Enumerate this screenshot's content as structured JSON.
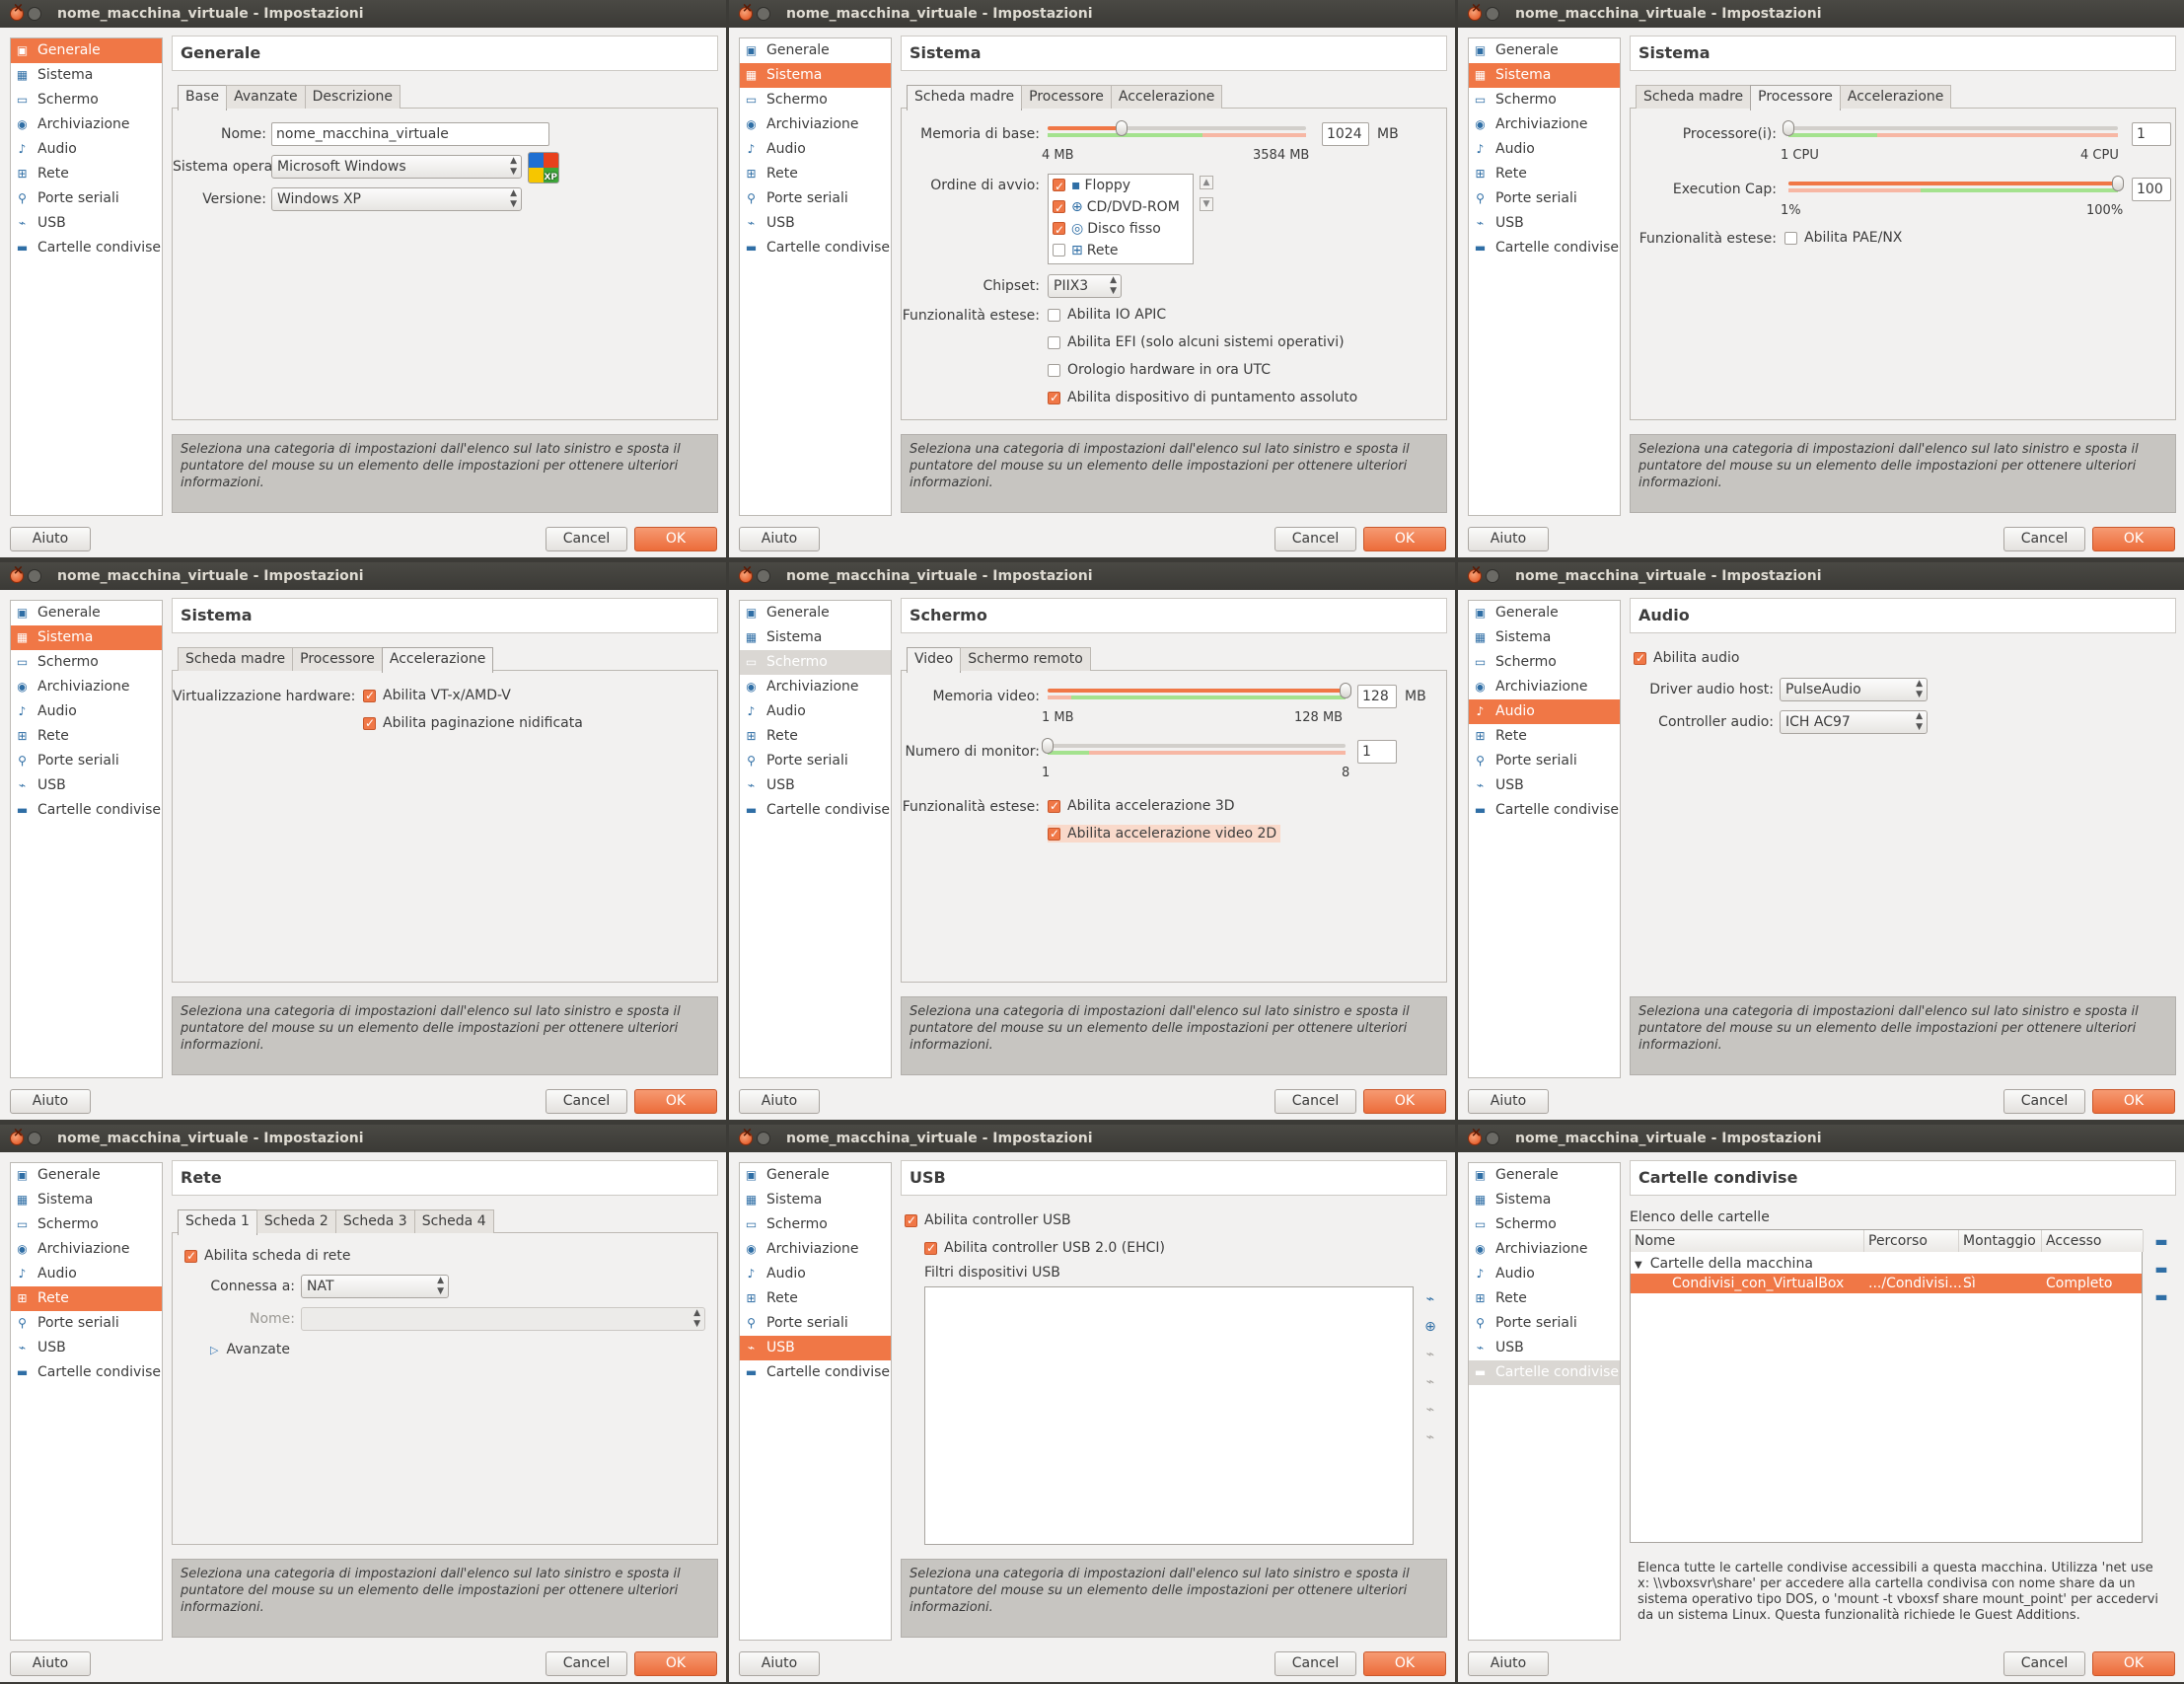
{
  "window_title": "nome_macchina_virtuale - Impostazioni",
  "sidebar": [
    "Generale",
    "Sistema",
    "Schermo",
    "Archiviazione",
    "Audio",
    "Rete",
    "Porte seriali",
    "USB",
    "Cartelle condivise"
  ],
  "sidebar_icons": [
    "general-icon",
    "system-icon",
    "display-icon",
    "storage-icon",
    "audio-icon",
    "network-icon",
    "serial-ports-icon",
    "usb-icon",
    "shared-folders-icon"
  ],
  "info_text": "Seleziona una categoria di impostazioni dall'elenco sul lato sinistro e sposta il puntatore del mouse su un elemento delle impostazioni per ottenere ulteriori informazioni.",
  "buttons": {
    "help": "Aiuto",
    "cancel": "Cancel",
    "ok": "OK"
  },
  "colors": {
    "accent": "#f07746",
    "titlebar": "#3b3a36",
    "background": "#f2f1f0"
  },
  "panels": {
    "generale": {
      "title": "Generale",
      "tabs": [
        "Base",
        "Avanzate",
        "Descrizione"
      ],
      "nome_label": "Nome:",
      "nome_value": "nome_macchina_virtuale",
      "os_label": "Sistema operativo:",
      "os_value": "Microsoft Windows",
      "version_label": "Versione:",
      "version_value": "Windows XP",
      "os_badge": "XP"
    },
    "sistema_scheda": {
      "title": "Sistema",
      "tabs": [
        "Scheda madre",
        "Processore",
        "Accelerazione"
      ],
      "mem_label": "Memoria di base:",
      "mem_value": "1024",
      "mem_unit": "MB",
      "mem_min": "4 MB",
      "mem_max": "3584 MB",
      "mem_fraction": 0.285,
      "boot_label": "Ordine di avvio:",
      "boot": [
        {
          "label": "Floppy",
          "checked": true,
          "icon": "floppy-icon"
        },
        {
          "label": "CD/DVD-ROM",
          "checked": true,
          "icon": "cdrom-icon"
        },
        {
          "label": "Disco fisso",
          "checked": true,
          "icon": "harddisk-icon"
        },
        {
          "label": "Rete",
          "checked": false,
          "icon": "network-icon"
        }
      ],
      "chipset_label": "Chipset:",
      "chipset_value": "PIIX3",
      "ext_label": "Funzionalità estese:",
      "ext": [
        {
          "label": "Abilita IO APIC",
          "checked": false
        },
        {
          "label": "Abilita EFI (solo alcuni sistemi operativi)",
          "checked": false
        },
        {
          "label": "Orologio hardware in ora UTC",
          "checked": false
        },
        {
          "label": "Abilita dispositivo di puntamento assoluto",
          "checked": true
        }
      ]
    },
    "sistema_proc": {
      "title": "Sistema",
      "tabs": [
        "Scheda madre",
        "Processore",
        "Accelerazione"
      ],
      "proc_label": "Processore(i):",
      "proc_value": "1",
      "proc_min": "1 CPU",
      "proc_max": "4 CPU",
      "proc_fraction": 0,
      "cap_label": "Execution Cap:",
      "cap_value": "100",
      "cap_min": "1%",
      "cap_max": "100%",
      "cap_fraction": 1,
      "ext_label": "Funzionalità estese:",
      "pae_label": "Abilita PAE/NX",
      "pae_checked": false
    },
    "sistema_acc": {
      "title": "Sistema",
      "tabs": [
        "Scheda madre",
        "Processore",
        "Accelerazione"
      ],
      "virt_label": "Virtualizzazione hardware:",
      "vtx_label": "Abilita VT-x/AMD-V",
      "nested_label": "Abilita paginazione nidificata"
    },
    "schermo": {
      "title": "Schermo",
      "tabs": [
        "Video",
        "Schermo remoto"
      ],
      "vmem_label": "Memoria video:",
      "vmem_value": "128",
      "vmem_unit": "MB",
      "vmem_min": "1 MB",
      "vmem_max": "128 MB",
      "vmem_fraction": 1,
      "mon_label": "Numero di monitor:",
      "mon_value": "1",
      "mon_min": "1",
      "mon_max": "8",
      "mon_fraction": 0,
      "ext_label": "Funzionalità estese:",
      "acc3d_label": "Abilita accelerazione 3D",
      "acc2d_label": "Abilita accelerazione video 2D"
    },
    "audio": {
      "title": "Audio",
      "enable_label": "Abilita audio",
      "driver_label": "Driver audio host:",
      "driver_value": "PulseAudio",
      "controller_label": "Controller audio:",
      "controller_value": "ICH AC97"
    },
    "rete": {
      "title": "Rete",
      "tabs": [
        "Scheda 1",
        "Scheda 2",
        "Scheda 3",
        "Scheda 4"
      ],
      "enable_label": "Abilita scheda di rete",
      "attached_label": "Connessa a:",
      "attached_value": "NAT",
      "name_label": "Nome:",
      "name_value": "",
      "advanced_label": "Avanzate"
    },
    "usb": {
      "title": "USB",
      "enable_label": "Abilita controller USB",
      "ehci_label": "Abilita controller USB 2.0 (EHCI)",
      "filters_label": "Filtri dispositivi USB",
      "filter_icons": [
        "add-filter-icon",
        "add-device-filter-icon",
        "edit-filter-icon",
        "remove-filter-icon",
        "move-up-icon",
        "move-down-icon"
      ]
    },
    "cartelle": {
      "title": "Cartelle condivise",
      "list_label": "Elenco delle cartelle",
      "columns": [
        "Nome",
        "Percorso",
        "Montaggio",
        "Accesso"
      ],
      "group": "Cartelle della macchina",
      "rows": [
        {
          "name": "Condivisi_con_VirtualBox",
          "path": ".../Condivisi...",
          "mount": "Sì",
          "access": "Completo"
        }
      ],
      "side_icons": [
        "add-folder-icon",
        "edit-folder-icon",
        "remove-folder-icon"
      ],
      "info": "Elenca tutte le cartelle condivise accessibili a questa macchina. Utilizza 'net use x: \\\\vboxsvr\\share' per accedere alla cartella condivisa con nome share da un sistema operativo tipo DOS, o 'mount -t vboxsf share mount_point' per accedervi da un sistema Linux. Questa funzionalità richiede le Guest Additions."
    }
  }
}
